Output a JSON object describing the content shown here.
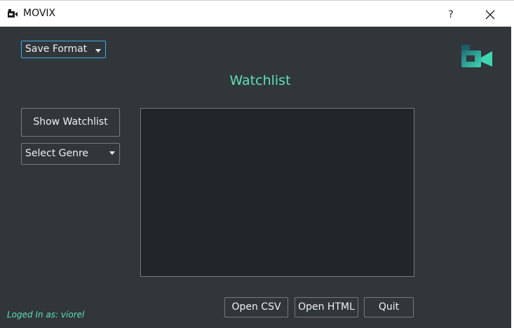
{
  "window": {
    "title": "MOVIX",
    "help_label": "?"
  },
  "controls": {
    "save_format": "Save Format",
    "show_watchlist": "Show Watchlist",
    "select_genre": "Select Genre"
  },
  "main": {
    "heading": "Watchlist",
    "list_items": []
  },
  "footer": {
    "open_csv": "Open CSV",
    "open_html": "Open HTML",
    "quit": "Quit",
    "status": "Loged In as: viorel"
  },
  "icons": {
    "app": "video-camera-icon",
    "logo": "video-camera-icon",
    "close": "close-icon",
    "dropdown": "chevron-down-icon"
  },
  "colors": {
    "background": "#31363b",
    "panel": "#232629",
    "border": "#76797c",
    "accent": "#5fe0b4",
    "focus": "#3daee9",
    "text": "#eff0f1"
  }
}
